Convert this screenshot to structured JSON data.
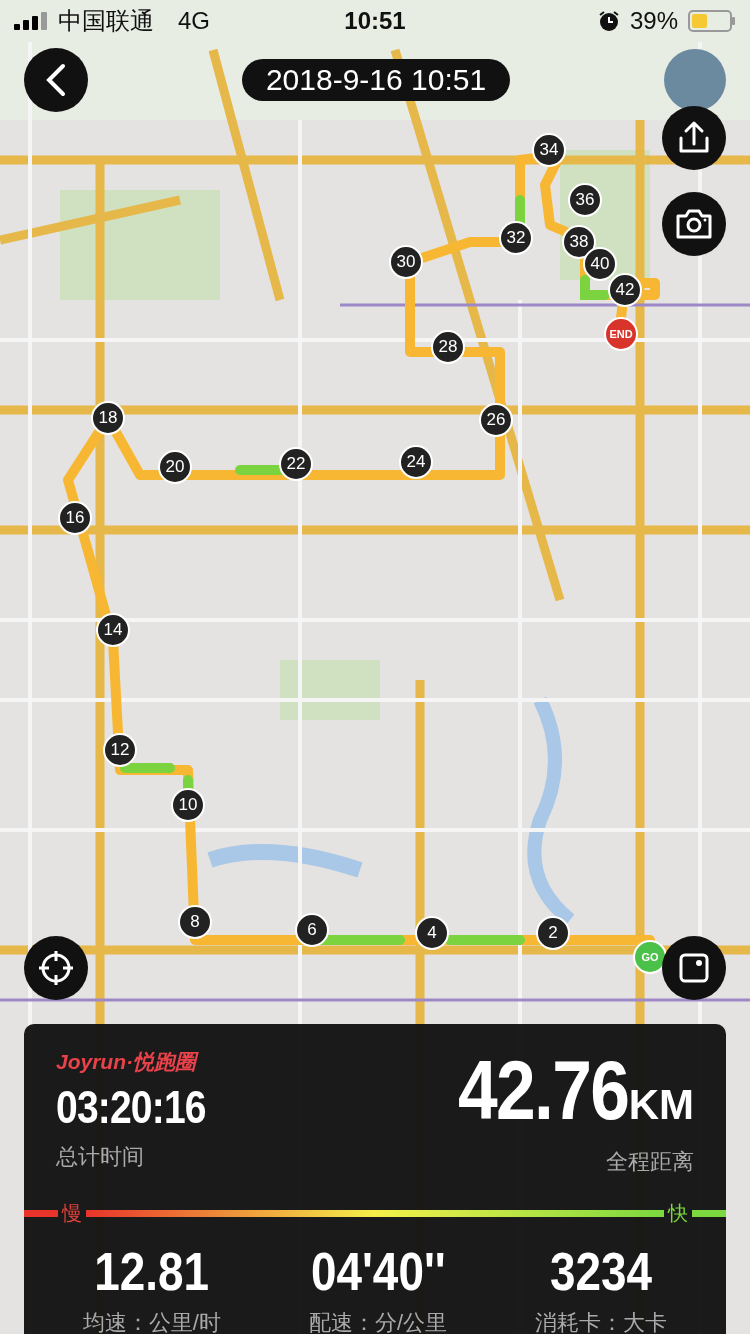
{
  "status_bar": {
    "carrier": "中国联通",
    "network": "4G",
    "time": "10:51",
    "battery": "39%"
  },
  "header": {
    "date_time": "2018-9-16 10:51"
  },
  "route_markers": [
    {
      "kind": "km",
      "label": "34"
    },
    {
      "kind": "km",
      "label": "36"
    },
    {
      "kind": "km",
      "label": "32"
    },
    {
      "kind": "km",
      "label": "38"
    },
    {
      "kind": "km",
      "label": "30"
    },
    {
      "kind": "km",
      "label": "40"
    },
    {
      "kind": "km",
      "label": "42"
    },
    {
      "kind": "end",
      "label": "END"
    },
    {
      "kind": "km",
      "label": "28"
    },
    {
      "kind": "km",
      "label": "18"
    },
    {
      "kind": "km",
      "label": "26"
    },
    {
      "kind": "km",
      "label": "20"
    },
    {
      "kind": "km",
      "label": "22"
    },
    {
      "kind": "km",
      "label": "24"
    },
    {
      "kind": "km",
      "label": "16"
    },
    {
      "kind": "km",
      "label": "14"
    },
    {
      "kind": "km",
      "label": "12"
    },
    {
      "kind": "km",
      "label": "10"
    },
    {
      "kind": "km",
      "label": "8"
    },
    {
      "kind": "km",
      "label": "6"
    },
    {
      "kind": "km",
      "label": "4"
    },
    {
      "kind": "km",
      "label": "2"
    },
    {
      "kind": "start",
      "label": "GO"
    }
  ],
  "summary": {
    "brand": "Joyrun·悦跑圈",
    "total_time": "03:20:16",
    "total_time_label": "总计时间",
    "distance": "42.76",
    "distance_unit": "KM",
    "distance_label": "全程距离",
    "pace_scale": {
      "slow": "慢",
      "fast": "快"
    },
    "stats": [
      {
        "value": "12.81",
        "label": "均速：公里/时"
      },
      {
        "value": "04'40''",
        "label": "配速：分/公里"
      },
      {
        "value": "3234",
        "label": "消耗卡：大卡"
      }
    ]
  }
}
